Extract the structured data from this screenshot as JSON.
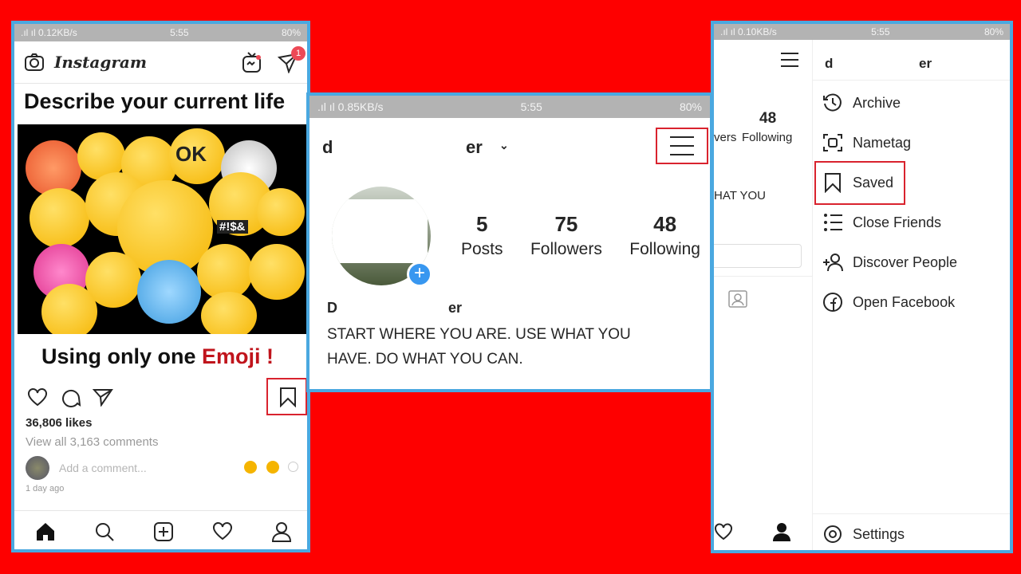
{
  "panel1": {
    "status": {
      "left": ".ıl ıl 0.12KB/s",
      "time": "5:55",
      "right": "80%"
    },
    "header": {
      "logo": "Instagram",
      "dm_badge": "1",
      "icons": [
        "camera-icon",
        "igtv-icon",
        "direct-message-icon"
      ]
    },
    "post": {
      "title": "Describe your current life",
      "subtitle_prefix": "Using only one ",
      "subtitle_highlight": "Emoji !",
      "image_text": [
        "OK",
        "#!$&"
      ],
      "likes": "36,806 likes",
      "comments_link": "View all 3,163 comments",
      "comment_placeholder": "Add a comment...",
      "time": "1 day ago"
    },
    "nav": [
      "home-icon",
      "search-icon",
      "add-post-icon",
      "activity-icon",
      "profile-icon"
    ]
  },
  "panel2": {
    "status": {
      "left": ".ıl ıl 0.85KB/s",
      "time": "5:55",
      "right": "80%"
    },
    "username_start": "d",
    "username_end": "er",
    "stats": [
      {
        "value": "5",
        "label": "Posts"
      },
      {
        "value": "75",
        "label": "Followers"
      },
      {
        "value": "48",
        "label": "Following"
      }
    ],
    "name_start": "D",
    "name_end": "er",
    "bio": [
      "START WHERE YOU ARE. USE WHAT YOU",
      "HAVE. DO WHAT YOU CAN."
    ]
  },
  "panel3": {
    "status": {
      "left": ".ıl ıl 0.10KB/s",
      "time": "5:55",
      "right": "80%"
    },
    "partial": {
      "stat_value": "48",
      "stat_label_left": "vers",
      "stat_label": "Following",
      "bio_fragment": "HAT YOU"
    },
    "drawer": {
      "username_start": "d",
      "username_end": "er",
      "items": [
        {
          "label": "Archive",
          "icon": "archive-icon"
        },
        {
          "label": "Nametag",
          "icon": "nametag-icon"
        },
        {
          "label": "Saved",
          "icon": "bookmark-icon"
        },
        {
          "label": "Close Friends",
          "icon": "close-friends-icon"
        },
        {
          "label": "Discover People",
          "icon": "discover-people-icon"
        },
        {
          "label": "Open Facebook",
          "icon": "facebook-icon"
        }
      ],
      "settings": "Settings"
    }
  },
  "colors": {
    "background": "#fe0000",
    "panel_border": "#4aa8e0",
    "highlight_box": "#d9232e",
    "emoji_word": "#c0141c",
    "add_button": "#3897f0"
  }
}
